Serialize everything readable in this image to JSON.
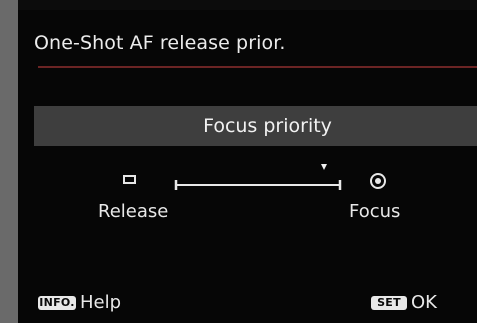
{
  "menu": {
    "title": "One-Shot AF release prior.",
    "selected_value": "Focus priority",
    "slider": {
      "left_label": "Release",
      "right_label": "Focus",
      "left_icon": "release-rectangle-icon",
      "right_icon": "focus-target-icon",
      "position": 1.0
    }
  },
  "footer": {
    "help_key": "INFO.",
    "help_label": "Help",
    "ok_key": "SET",
    "ok_label": "OK"
  },
  "colors": {
    "background": "#060606",
    "title_rule": "#6b2424",
    "selection_bar": "#3e3e3e",
    "text": "#e8e8e8"
  }
}
